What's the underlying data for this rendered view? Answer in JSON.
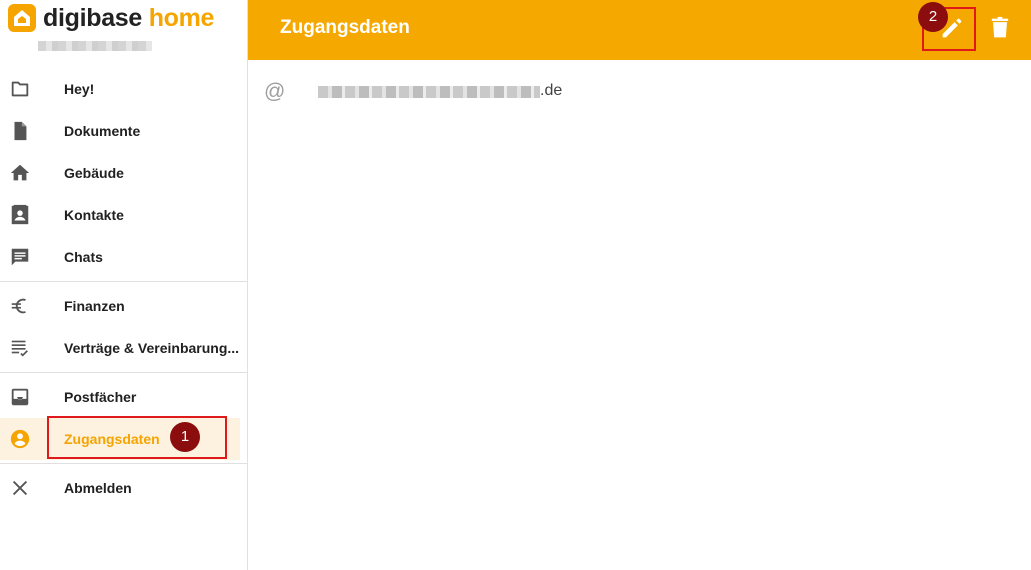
{
  "brand": {
    "word1": "digibase",
    "word2": "home",
    "accent": "#f5a400"
  },
  "sidebar": {
    "items": [
      {
        "label": "Hey!",
        "icon": "folder-icon"
      },
      {
        "label": "Dokumente",
        "icon": "document-icon"
      },
      {
        "label": "Gebäude",
        "icon": "home-icon"
      },
      {
        "label": "Kontakte",
        "icon": "contacts-icon"
      },
      {
        "label": "Chats",
        "icon": "chat-icon"
      },
      {
        "label": "Finanzen",
        "icon": "euro-icon"
      },
      {
        "label": "Verträge & Vereinbarung...",
        "icon": "list-check-icon"
      },
      {
        "label": "Postfächer",
        "icon": "inbox-icon"
      },
      {
        "label": "Zugangsdaten",
        "icon": "account-circle-icon",
        "active": true
      },
      {
        "label": "Abmelden",
        "icon": "close-icon"
      }
    ]
  },
  "header": {
    "title": "Zugangsdaten",
    "edit_icon": "pencil-icon",
    "delete_icon": "trash-icon"
  },
  "content": {
    "email_icon": "@",
    "email_suffix": ".de"
  },
  "annotations": {
    "marker1": "1",
    "marker2": "2",
    "highlight_color": "#e0191b"
  }
}
